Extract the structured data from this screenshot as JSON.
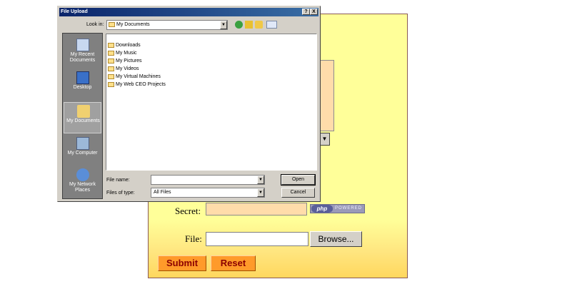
{
  "form": {
    "secret_label": "Secret:",
    "file_label": "File:",
    "browse_label": "Browse...",
    "submit_label": "Submit",
    "reset_label": "Reset",
    "php_badge_logo": "php",
    "php_badge_text": "POWERED",
    "combo_arrow": "▼"
  },
  "dialog": {
    "title": "File Upload",
    "help_button": "?",
    "close_button": "X",
    "look_in_label": "Look in:",
    "look_in_value": "My Documents",
    "combo_arrow": "▼",
    "places": [
      {
        "label": "My Recent Documents",
        "icon": "recent-documents-icon"
      },
      {
        "label": "Desktop",
        "icon": "desktop-icon"
      },
      {
        "label": "My Documents",
        "icon": "my-documents-icon"
      },
      {
        "label": "My Computer",
        "icon": "my-computer-icon"
      },
      {
        "label": "My Network Places",
        "icon": "network-places-icon"
      }
    ],
    "files": [
      {
        "name": "Downloads",
        "icon": "folder-icon"
      },
      {
        "name": "My Music",
        "icon": "folder-icon"
      },
      {
        "name": "My Pictures",
        "icon": "folder-icon"
      },
      {
        "name": "My Videos",
        "icon": "folder-icon"
      },
      {
        "name": "My Virtual Machines",
        "icon": "folder-icon"
      },
      {
        "name": "My Web CEO Projects",
        "icon": "folder-icon"
      }
    ],
    "file_name_label": "File name:",
    "file_name_value": "",
    "files_of_type_label": "Files of type:",
    "files_of_type_value": "All Files",
    "open_label": "Open",
    "cancel_label": "Cancel"
  },
  "colors": {
    "form_background": "#ffff99",
    "input_fill": "#ffdcaa",
    "button_orange": "#ff9a2a",
    "button_text": "#8b0000",
    "dialog_face": "#d4d0c8",
    "titlebar": "#0a246a"
  }
}
